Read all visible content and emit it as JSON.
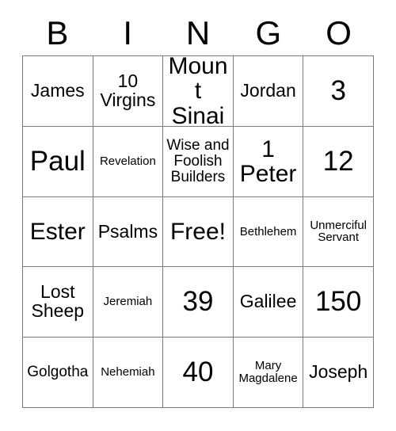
{
  "card": {
    "header": {
      "letters": [
        "B",
        "I",
        "N",
        "G",
        "O"
      ]
    },
    "free_space_label": "Free!",
    "colors": {
      "border": "#7a7a7a",
      "cell_background": "#ffffff",
      "text": "#000000",
      "page_background": "#ffffff"
    },
    "rows": [
      [
        {
          "text": "James",
          "size": "md"
        },
        {
          "text": "10\nVirgins",
          "size": "md"
        },
        {
          "text": "Mount\nSinai",
          "size": "lg"
        },
        {
          "text": "Jordan",
          "size": "md"
        },
        {
          "text": "3",
          "size": "xl"
        }
      ],
      [
        {
          "text": "Paul",
          "size": "xl"
        },
        {
          "text": "Revelation",
          "size": "xs"
        },
        {
          "text": "Wise and\nFoolish\nBuilders",
          "size": "sm"
        },
        {
          "text": "1\nPeter",
          "size": "lg"
        },
        {
          "text": "12",
          "size": "xl"
        }
      ],
      [
        {
          "text": "Ester",
          "size": "lg"
        },
        {
          "text": "Psalms",
          "size": "md"
        },
        {
          "text": "Free!",
          "size": "lg"
        },
        {
          "text": "Bethlehem",
          "size": "xs"
        },
        {
          "text": "Unmerciful\nServant",
          "size": "xs"
        }
      ],
      [
        {
          "text": "Lost\nSheep",
          "size": "md"
        },
        {
          "text": "Jeremiah",
          "size": "xs"
        },
        {
          "text": "39",
          "size": "xl"
        },
        {
          "text": "Galilee",
          "size": "md"
        },
        {
          "text": "150",
          "size": "xl"
        }
      ],
      [
        {
          "text": "Golgotha",
          "size": "sm"
        },
        {
          "text": "Nehemiah",
          "size": "xs"
        },
        {
          "text": "40",
          "size": "xl"
        },
        {
          "text": "Mary\nMagdalene",
          "size": "xs"
        },
        {
          "text": "Joseph",
          "size": "md"
        }
      ]
    ]
  }
}
